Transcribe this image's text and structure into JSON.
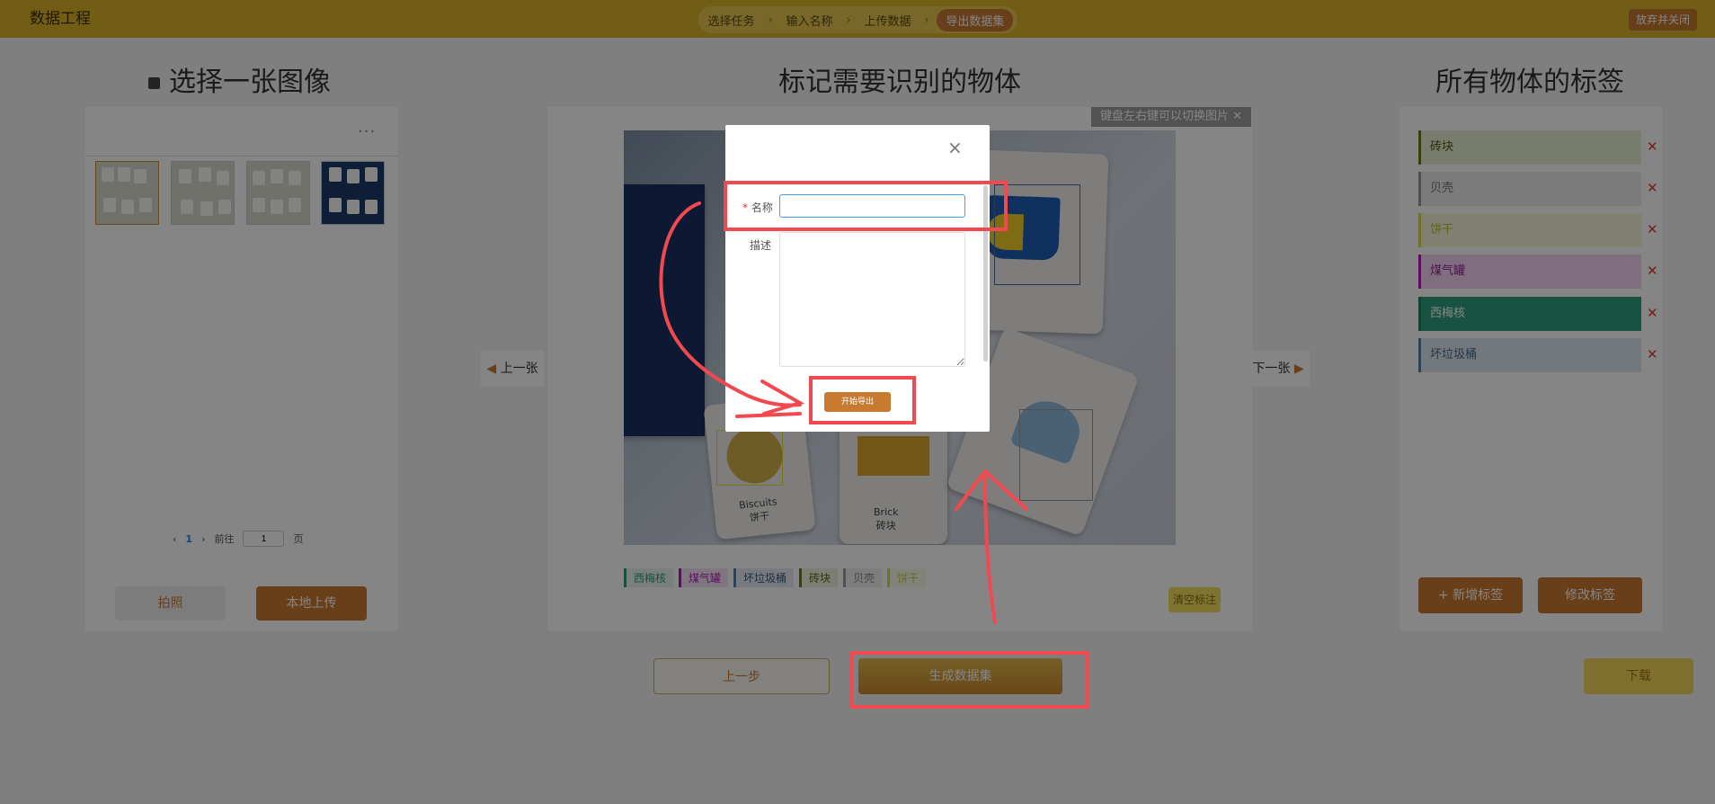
{
  "app": {
    "title": "数据工程",
    "abandon_label": "放弃并关闭"
  },
  "steps": [
    {
      "label": "选择任务",
      "active": false
    },
    {
      "label": "输入名称",
      "active": false
    },
    {
      "label": "上传数据",
      "active": false
    },
    {
      "label": "导出数据集",
      "active": true
    }
  ],
  "left_panel": {
    "title": "选择一张图像",
    "more_label": "···",
    "pagination": {
      "current": "1",
      "goto_label": "前往",
      "goto_value": "1",
      "page_suffix": "页"
    },
    "camera_label": "拍照",
    "upload_label": "本地上传"
  },
  "center_panel": {
    "title": "标记需要识别的物体",
    "tip": "键盘左右键可以切换图片",
    "prev_label": "上一张",
    "next_label": "下一张",
    "tags": [
      {
        "label": "西梅核",
        "color": "#2e9a7a"
      },
      {
        "label": "煤气罐",
        "color": "#b01fb0"
      },
      {
        "label": "坏垃圾桶",
        "color": "#5a7da3"
      },
      {
        "label": "砖块",
        "color": "#6a7a18"
      },
      {
        "label": "贝壳",
        "color": "#999999"
      },
      {
        "label": "饼干",
        "color": "#d4da4c"
      }
    ],
    "clear_label": "清空标注",
    "card_texts": {
      "biscuits": "Biscuits",
      "biscuits_cn": "饼干",
      "brick": "Brick",
      "brick_cn": "砖块"
    }
  },
  "right_panel": {
    "title": "所有物体的标签",
    "labels": [
      {
        "label": "砖块",
        "bg": "#e7edd0",
        "border": "#6a7a18",
        "text": "#4a5510"
      },
      {
        "label": "贝壳",
        "bg": "#ececec",
        "border": "#9a9a9a",
        "text": "#777777"
      },
      {
        "label": "饼干",
        "bg": "#f6f8d8",
        "border": "#d4da4c",
        "text": "#b8bd3a"
      },
      {
        "label": "煤气罐",
        "bg": "#f2d3f2",
        "border": "#b01fb0",
        "text": "#9a1a9a"
      },
      {
        "label": "西梅核",
        "bg": "#2fa07f",
        "border": "#23806a",
        "text": "#ffffff"
      },
      {
        "label": "坏垃圾桶",
        "bg": "#dce6f0",
        "border": "#5a7da3",
        "text": "#4a6a8a"
      }
    ],
    "delete_label": "✕",
    "add_label": "+ 新增标签",
    "edit_label": "修改标签"
  },
  "footer": {
    "prev_step_label": "上一步",
    "generate_label": "生成数据集",
    "download_label": "下载"
  },
  "dialog": {
    "close_label": "×",
    "required_mark": "*",
    "name_label": "名称",
    "name_value": "",
    "desc_label": "描述",
    "desc_value": "",
    "export_label": "开始导出"
  },
  "colors": {
    "accent": "#c87a31",
    "topbar": "#d9b227",
    "highlight": "#f04a50"
  }
}
